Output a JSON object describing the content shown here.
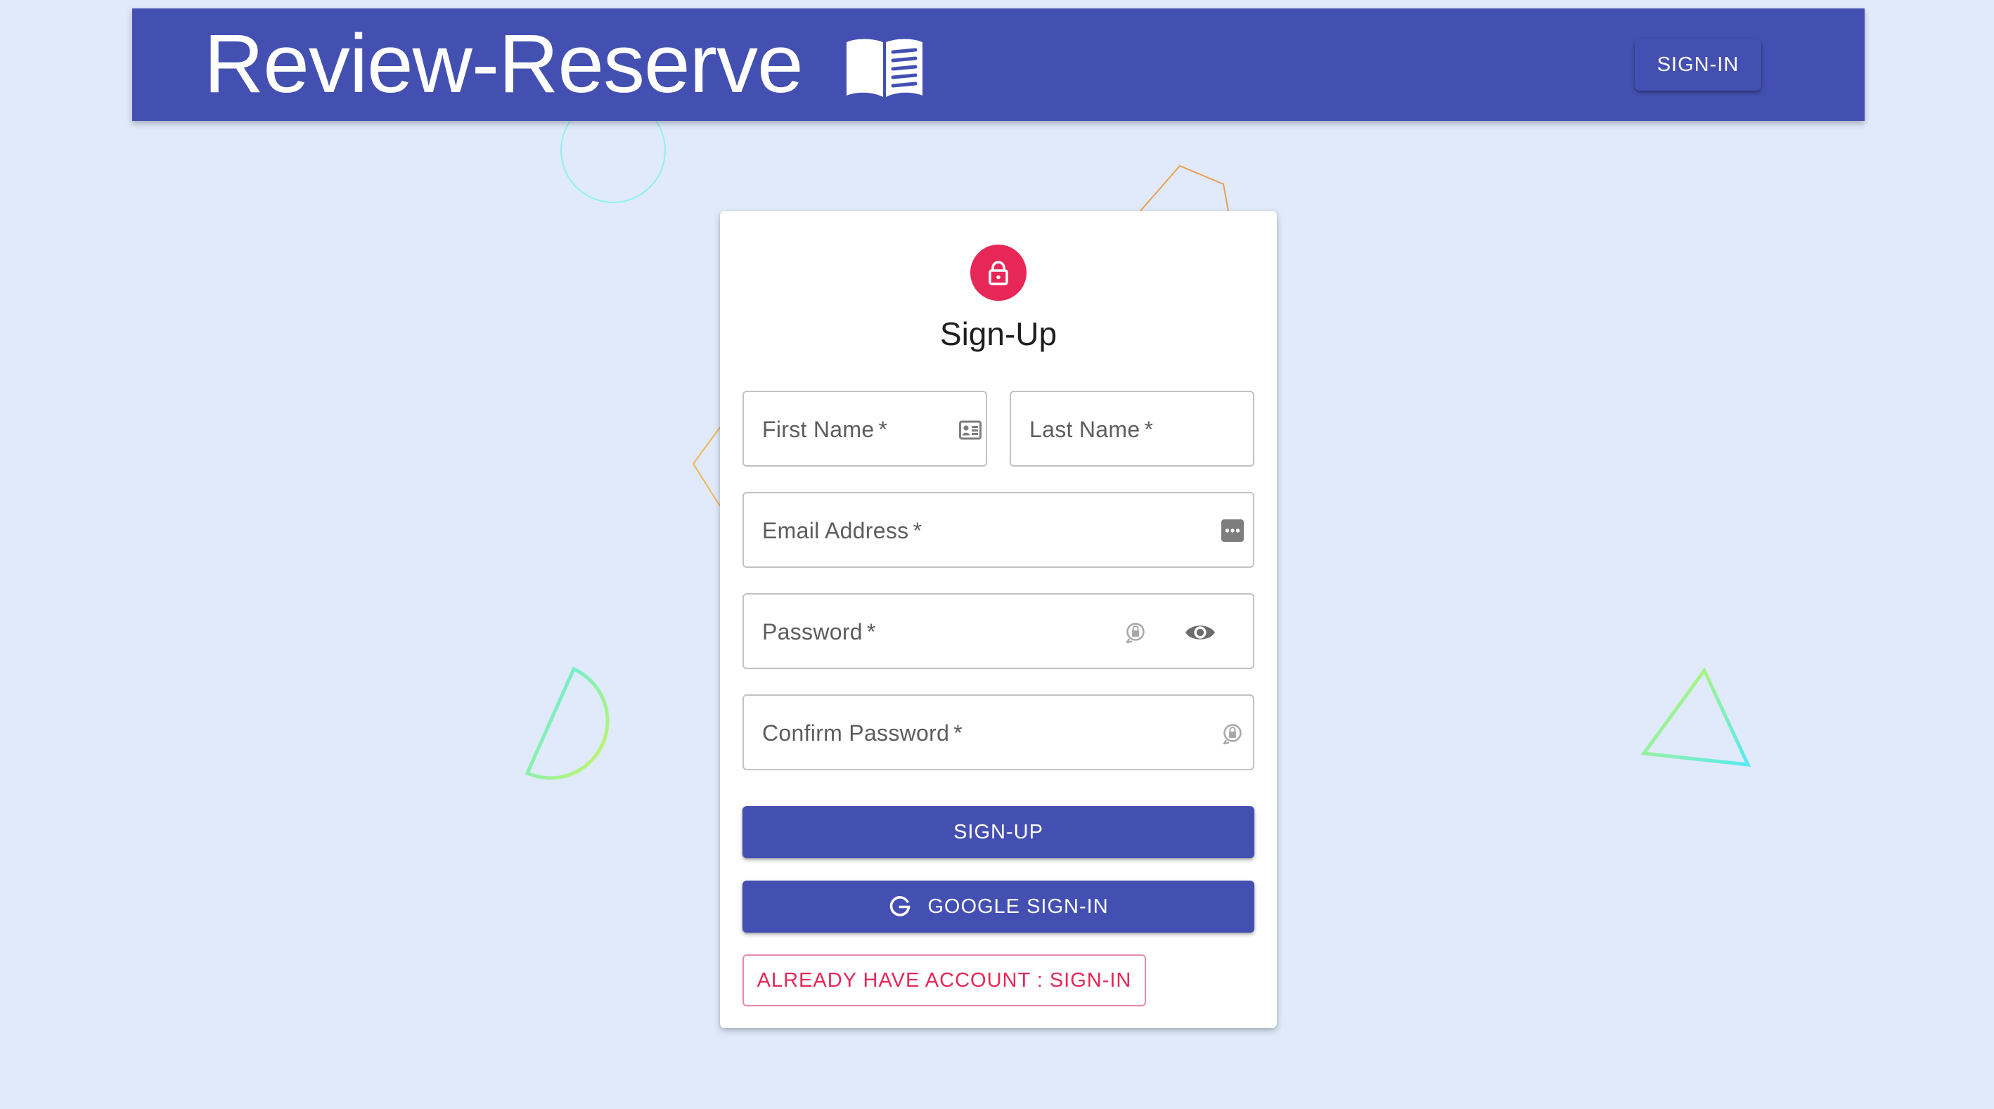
{
  "header": {
    "brand_title": "Review-Reserve",
    "brand_icon": "open-book-icon",
    "signin_label": "SIGN-IN",
    "background_color": "#4450b1"
  },
  "form": {
    "avatar_icon": "lock-icon",
    "avatar_color": "#e62757",
    "title": "Sign-Up",
    "fields": {
      "first_name": {
        "label": "First Name",
        "required_mark": "*",
        "icon": "contact-card-icon"
      },
      "last_name": {
        "label": "Last Name",
        "required_mark": "*"
      },
      "email": {
        "label": "Email Address",
        "required_mark": "*",
        "icon": "more-dots-icon"
      },
      "password": {
        "label": "Password",
        "required_mark": "*",
        "icon": "password-key-icon",
        "toggle_icon": "eye-icon"
      },
      "confirm_password": {
        "label": "Confirm Password",
        "required_mark": "*",
        "icon": "password-key-icon"
      }
    },
    "signup_label": "SIGN-UP",
    "google_label": "GOOGLE SIGN-IN",
    "google_icon": "google-g-icon",
    "already_label": "ALREADY HAVE ACCOUNT : SIGN-IN",
    "primary_color": "#4450b1",
    "secondary_color": "#e62757"
  },
  "page": {
    "background_color": "#e0eafb"
  }
}
